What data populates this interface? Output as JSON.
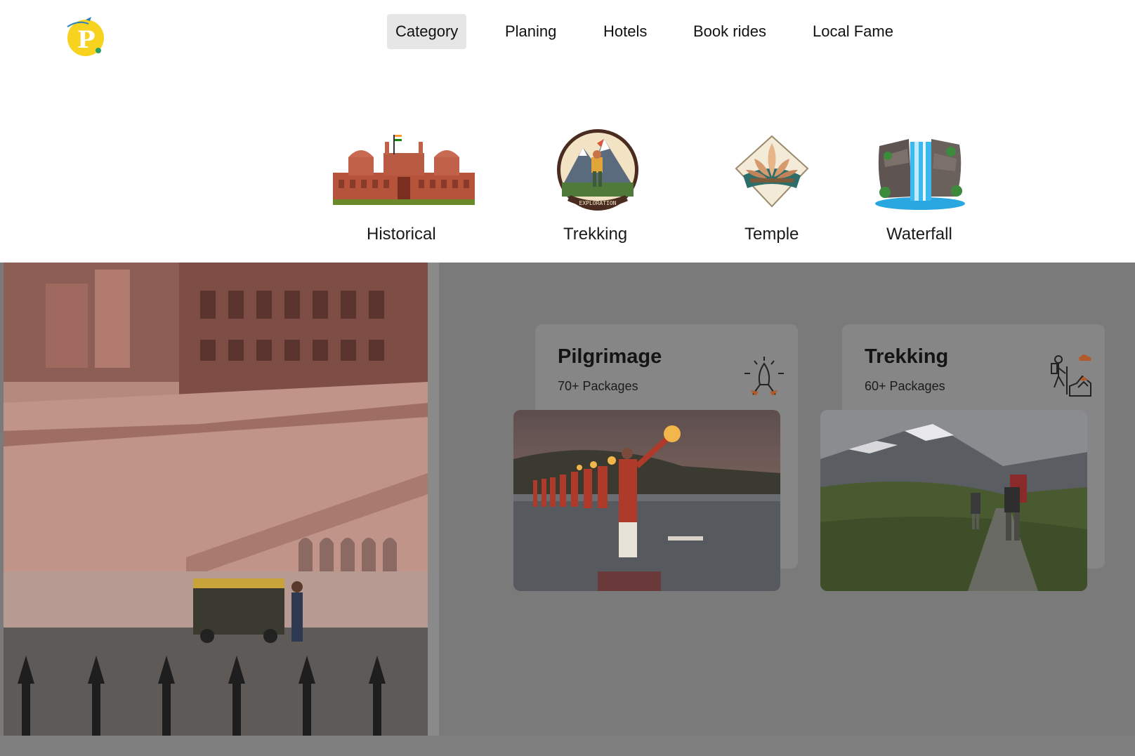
{
  "logo": {
    "letter": "P",
    "color": "#f7d21e"
  },
  "nav": [
    {
      "label": "Category",
      "active": true
    },
    {
      "label": "Planing",
      "active": false
    },
    {
      "label": "Hotels",
      "active": false
    },
    {
      "label": "Book rides",
      "active": false
    },
    {
      "label": "Local Fame",
      "active": false
    }
  ],
  "categories": [
    {
      "label": "Historical",
      "icon": "red-fort-icon"
    },
    {
      "label": "Trekking",
      "icon": "exploration-badge-icon",
      "badge_text": "EXPLORATION"
    },
    {
      "label": "Temple",
      "icon": "lotus-temple-icon"
    },
    {
      "label": "Waterfall",
      "icon": "waterfall-icon"
    }
  ],
  "cards": [
    {
      "title": "Pilgrimage",
      "subtitle": "70+ Packages",
      "icon": "aarti-lamp-icon",
      "photo": "ganga-aarti-photo"
    },
    {
      "title": "Trekking",
      "subtitle": "60+ Packages",
      "icon": "hiker-icon",
      "photo": "mountain-trek-photo"
    }
  ],
  "left_photo": "rajasthan-palace-photo"
}
